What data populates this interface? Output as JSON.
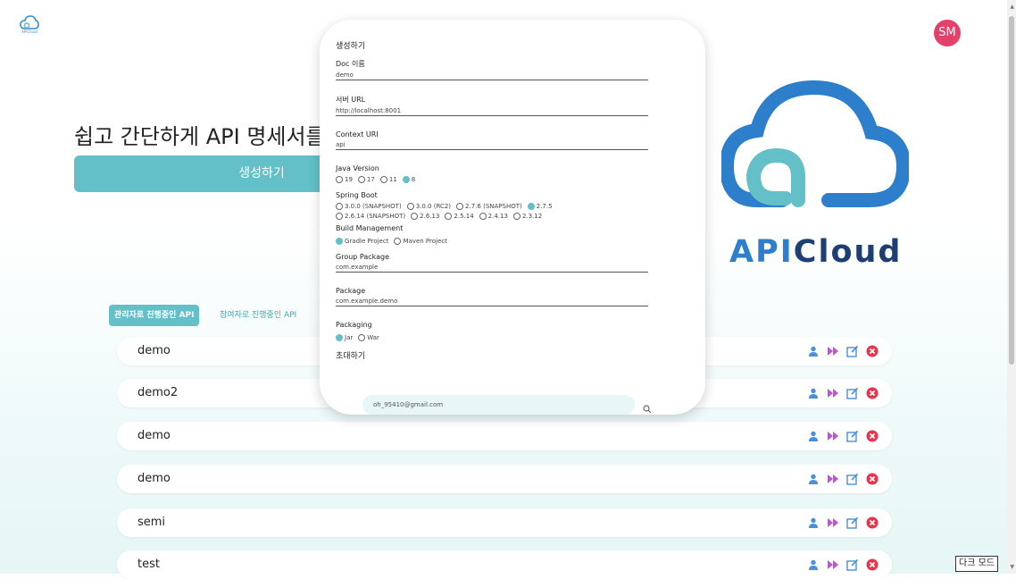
{
  "header": {
    "logo_caption": "APICloud",
    "avatar_initials": "SM"
  },
  "hero": {
    "title": "쉽고 간단하게 API 명세서를 만들어보세요",
    "create_button": "생성하기"
  },
  "brand": {
    "text_api": "API",
    "text_cloud": "Cloud"
  },
  "tabs": {
    "admin": "관리자로 진행중인 API",
    "participant": "참여자로 진행중인 API"
  },
  "rows": [
    {
      "name": "demo"
    },
    {
      "name": "demo2"
    },
    {
      "name": "demo"
    },
    {
      "name": "demo"
    },
    {
      "name": "semi"
    },
    {
      "name": "test"
    }
  ],
  "modal": {
    "title": "생성하기",
    "doc_name_label": "Doc 이름",
    "doc_name_value": "demo",
    "server_url_label": "서버 URL",
    "server_url_value": "http://localhost:8001",
    "context_uri_label": "Context URI",
    "context_uri_value": "api",
    "java_version_label": "Java Version",
    "java_versions": [
      "19",
      "17",
      "11",
      "8"
    ],
    "java_selected": "8",
    "spring_boot_label": "Spring Boot",
    "spring_boot_options": [
      "3.0.0 (SNAPSHOT)",
      "3.0.0 (RC2)",
      "2.7.6 (SNAPSHOT)",
      "2.7.5",
      "2.6.14 (SNAPSHOT)",
      "2.6.13",
      "2.5.14",
      "2.4.13",
      "2.3.12"
    ],
    "spring_boot_selected": "2.7.5",
    "build_label": "Build Management",
    "build_options": [
      "Gradle Project",
      "Maven Project"
    ],
    "build_selected": "Gradle Project",
    "group_package_label": "Group Package",
    "group_package_value": "com.example",
    "package_label": "Package",
    "package_value": "com.example.demo",
    "packaging_label": "Packaging",
    "packaging_options": [
      "Jar",
      "War"
    ],
    "packaging_selected": "Jar",
    "invite_label": "초대하기",
    "invite_value": "oh_95410@gmail.com"
  },
  "dark_mode_label": "다크 모드",
  "colors": {
    "accent": "#63c0c8",
    "brand_blue": "#2d7fcc",
    "brand_navy": "#1e3f73",
    "avatar": "#e4416a",
    "delete_red": "#e8344e",
    "user_icon": "#4a90d9",
    "run_icon": "#c44fd8"
  }
}
